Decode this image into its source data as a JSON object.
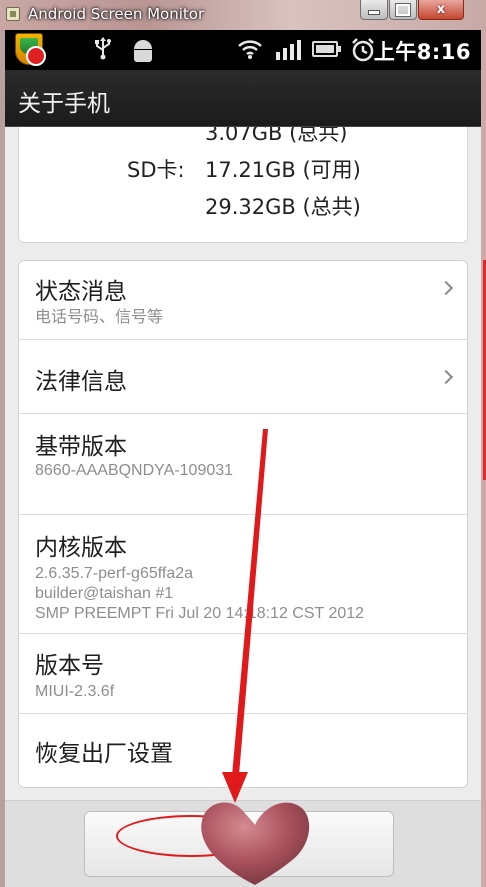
{
  "window": {
    "title": "Android Screen Monitor",
    "close_glyph": "x"
  },
  "status_bar": {
    "time": "上午8:16",
    "icons": [
      "security-shield-icon",
      "usb-icon",
      "android-debug-icon",
      "wifi-icon",
      "signal-icon",
      "battery-icon",
      "alarm-icon"
    ]
  },
  "action_bar": {
    "title": "关于手机"
  },
  "storage": {
    "internal_total": "3.07GB (总共)",
    "sd_label": "SD卡:",
    "sd_available": "17.21GB (可用)",
    "sd_total": "29.32GB (总共)"
  },
  "items": [
    {
      "title": "状态消息",
      "subtitle": "电话号码、信号等",
      "has_chevron": true
    },
    {
      "title": "法律信息",
      "subtitle": "",
      "has_chevron": true
    },
    {
      "title": "基带版本",
      "subtitle": "8660-AAABQNDYA-109031",
      "has_chevron": false
    },
    {
      "title": "内核版本",
      "subtitle_lines": [
        "2.6.35.7-perf-g65ffa2a",
        "builder@taishan #1",
        "SMP PREEMPT Fri Jul 20 14:18:12 CST 2012"
      ],
      "has_chevron": false
    },
    {
      "title": "版本号",
      "subtitle": "MIUI-2.3.6f",
      "has_chevron": false
    },
    {
      "title": "恢复出厂设置",
      "subtitle": "",
      "has_chevron": false
    }
  ],
  "colors": {
    "annotation_red": "#e01a1a",
    "action_bar": "#222222",
    "list_background": "#ececec"
  }
}
